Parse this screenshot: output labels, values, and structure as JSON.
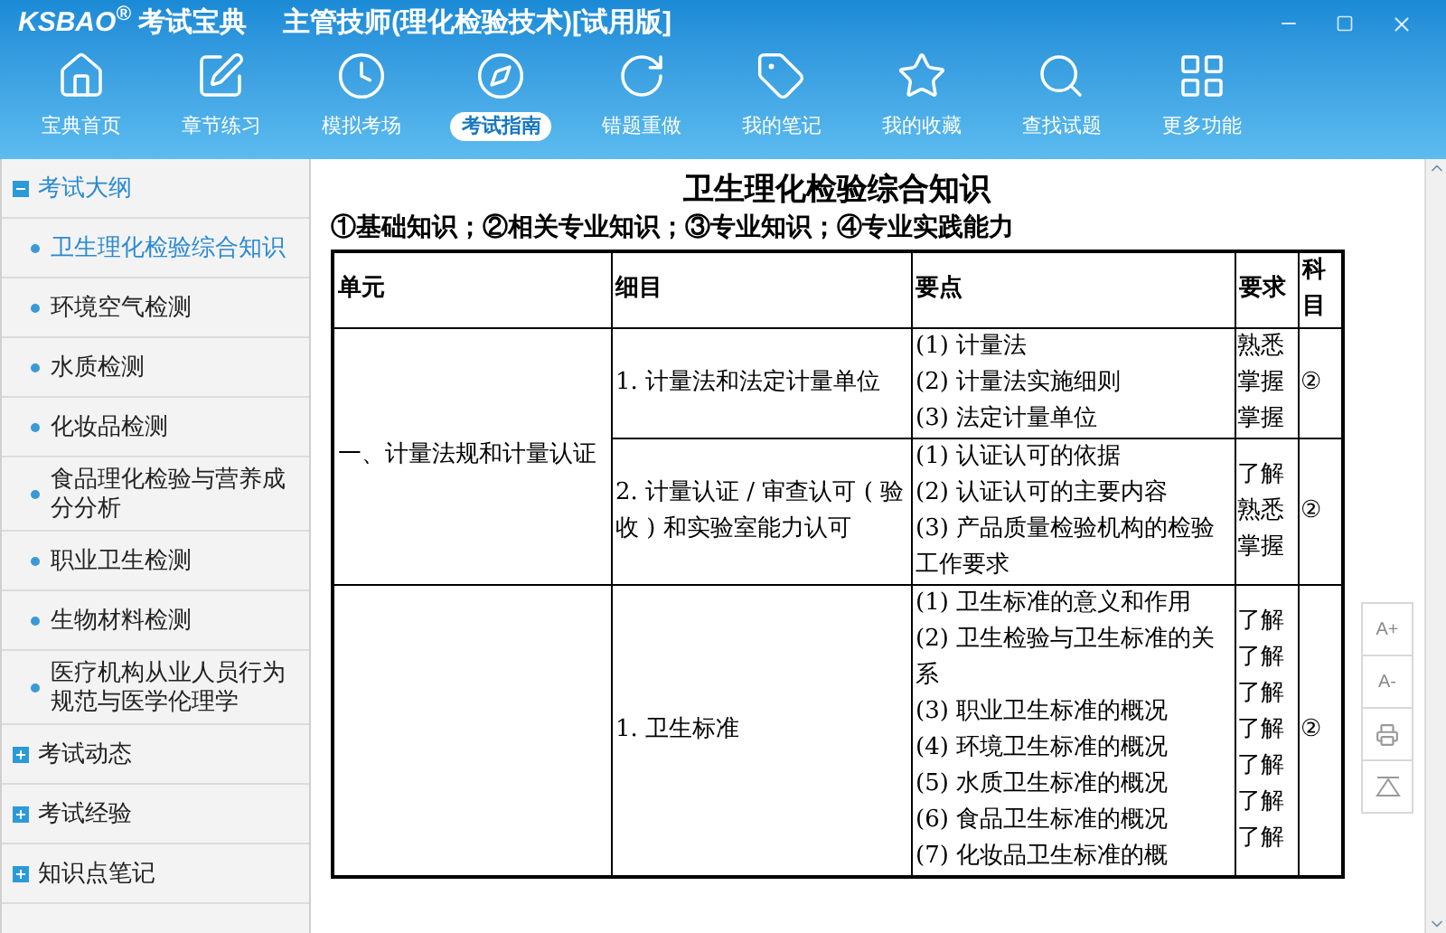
{
  "window": {
    "logo": "KSBAO$^{®}$",
    "brand": "考试宝典",
    "title": "主管技师(理化检验技术)[试用版]"
  },
  "nav": [
    {
      "label": "宝典首页",
      "selected": false
    },
    {
      "label": "章节练习",
      "selected": false
    },
    {
      "label": "模拟考场",
      "selected": false
    },
    {
      "label": "考试指南",
      "selected": true
    },
    {
      "label": "错题重做",
      "selected": false
    },
    {
      "label": "我的笔记",
      "selected": false
    },
    {
      "label": "我的收藏",
      "selected": false
    },
    {
      "label": "查找试题",
      "selected": false
    },
    {
      "label": "更多功能",
      "selected": false
    }
  ],
  "sidebar": {
    "groups": [
      {
        "label": "考试大纲",
        "expanded": true,
        "children": [
          {
            "label": "卫生理化检验综合知识",
            "selected": true
          },
          {
            "label": "环境空气检测",
            "selected": false
          },
          {
            "label": "水质检测",
            "selected": false
          },
          {
            "label": "化妆品检测",
            "selected": false
          },
          {
            "label": "食品理化检验与营养成分分析",
            "selected": false
          },
          {
            "label": "职业卫生检测",
            "selected": false
          },
          {
            "label": "生物材料检测",
            "selected": false
          },
          {
            "label": "医疗机构从业人员行为规范与医学伦理学",
            "selected": false
          }
        ]
      },
      {
        "label": "考试动态",
        "expanded": false
      },
      {
        "label": "考试经验",
        "expanded": false
      },
      {
        "label": "知识点笔记",
        "expanded": false
      }
    ]
  },
  "document": {
    "title": "卫生理化检验综合知识",
    "subtitle": "①基础知识；②相关专业知识；③专业知识；④专业实践能力",
    "table": {
      "columns": [
        "单元",
        "细目",
        "要点",
        "要求",
        "科目"
      ],
      "units": [
        {
          "unit": "一、计量法规和计量认证",
          "items": [
            {
              "detail": "1. 计量法和法定计量单位",
              "points": [
                "(1) 计量法",
                "(2) 计量法实施细则",
                "(3) 法定计量单位"
              ],
              "requirements": [
                "熟悉",
                "掌握",
                "掌握"
              ],
              "subject": "②"
            },
            {
              "detail": "2. 计量认证 / 审查认可 ( 验收 ) 和实验室能力认可",
              "points": [
                "(1) 认证认可的依据",
                "(2) 认证认可的主要内容",
                "(3) 产品质量检验机构的检验工作要求"
              ],
              "requirements": [
                "了解",
                "熟悉",
                "掌握"
              ],
              "subject": "②"
            }
          ]
        },
        {
          "items": [
            {
              "detail": "1. 卫生标准",
              "points": [
                "(1) 卫生标准的意义和作用",
                "(2) 卫生检验与卫生标准的关系",
                "(3) 职业卫生标准的概况",
                "(4) 环境卫生标准的概况",
                "(5) 水质卫生标准的概况",
                "(6) 食品卫生标准的概况",
                "(7) 化妆品卫生标准的概"
              ],
              "requirements": [
                "了解",
                "了解",
                "了解",
                "了解",
                "了解",
                "了解",
                "了解"
              ],
              "subject": "②"
            }
          ]
        }
      ]
    }
  },
  "tools": [
    "A+",
    "A-"
  ]
}
